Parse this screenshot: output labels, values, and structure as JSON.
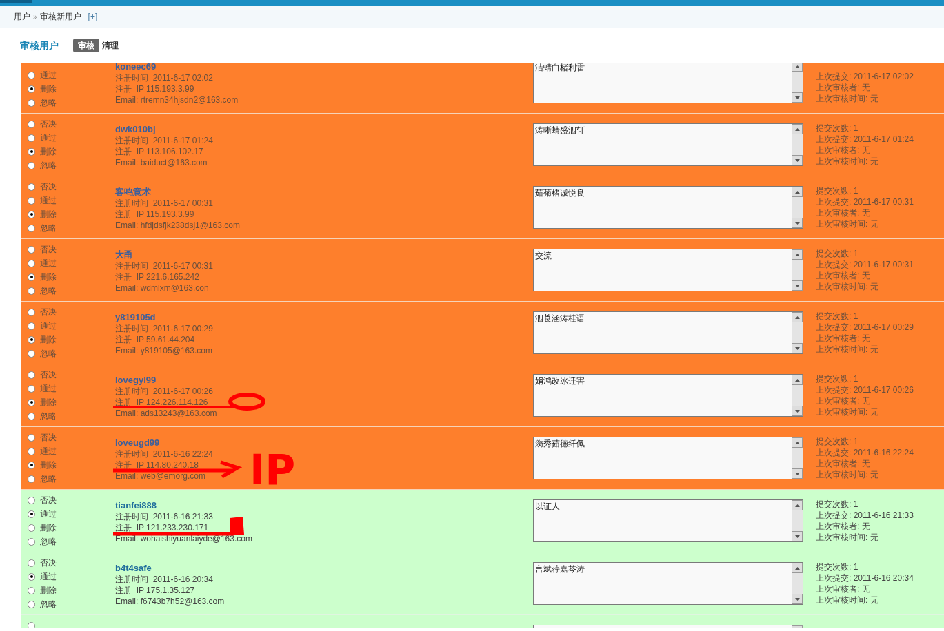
{
  "breadcrumb": {
    "items": [
      "用户",
      "审核新用户"
    ],
    "separator": "»",
    "add_link": "[+]"
  },
  "header": {
    "title": "审核用户",
    "tabs": [
      {
        "label": "审核",
        "selected": true
      },
      {
        "label": "清理",
        "selected": false
      }
    ]
  },
  "rows": [
    {
      "kind": "entry",
      "color": "#fe7f2c",
      "options": [
        {
          "label": "通过",
          "selected": false
        },
        {
          "label": "删除",
          "selected": true
        },
        {
          "label": "忽略",
          "selected": false
        }
      ],
      "username": "koneec69",
      "details": [
        "注册时间  2011-6-17 02:02",
        "注册  IP 115.193.3.99",
        "Email: rtremn34hjsdn2@163.com"
      ],
      "reason": "洁蜻白楮利雷",
      "stats": [
        "上次提交: 2011-6-17 02:02",
        "上次审核者: 无",
        "上次审核时间: 无"
      ]
    },
    {
      "kind": "entry",
      "color": "#fe7f2c",
      "options": [
        {
          "label": "否决",
          "selected": false
        },
        {
          "label": "通过",
          "selected": false
        },
        {
          "label": "删除",
          "selected": true
        },
        {
          "label": "忽略",
          "selected": false
        }
      ],
      "username": "dwk010bj",
      "details": [
        "注册时间  2011-6-17 01:24",
        "注册  IP 113.106.102.17",
        "Email: baiduct@163.com"
      ],
      "reason": "涛晰蜻盛泗轩",
      "stats": [
        "提交次数: 1",
        "上次提交: 2011-6-17 01:24",
        "上次审核者: 无",
        "上次审核时间: 无"
      ]
    },
    {
      "kind": "entry",
      "color": "#fe7f2c",
      "options": [
        {
          "label": "否决",
          "selected": false
        },
        {
          "label": "通过",
          "selected": false
        },
        {
          "label": "删除",
          "selected": true
        },
        {
          "label": "忽略",
          "selected": false
        }
      ],
      "username": "客鸣意术",
      "details": [
        "注册时间  2011-6-17 00:31",
        "注册  IP 115.193.3.99",
        "Email: hfdjdsfjk238dsj1@163.com"
      ],
      "reason": "茹菊楮诚悦良",
      "stats": [
        "提交次数: 1",
        "上次提交: 2011-6-17 00:31",
        "上次审核者: 无",
        "上次审核时间: 无"
      ]
    },
    {
      "kind": "entry",
      "color": "#fe7f2c",
      "options": [
        {
          "label": "否决",
          "selected": false
        },
        {
          "label": "通过",
          "selected": false
        },
        {
          "label": "删除",
          "selected": true
        },
        {
          "label": "忽略",
          "selected": false
        }
      ],
      "username": "大甬",
      "details": [
        "注册时间  2011-6-17 00:31",
        "注册  IP 221.6.165.242",
        "Email: wdmlxm@163.con"
      ],
      "reason": "交流",
      "stats": [
        "提交次数: 1",
        "上次提交: 2011-6-17 00:31",
        "上次审核者: 无",
        "上次审核时间: 无"
      ]
    },
    {
      "kind": "entry",
      "color": "#fe7f2c",
      "options": [
        {
          "label": "否决",
          "selected": false
        },
        {
          "label": "通过",
          "selected": false
        },
        {
          "label": "删除",
          "selected": true
        },
        {
          "label": "忽略",
          "selected": false
        }
      ],
      "username": "y819105d",
      "details": [
        "注册时间  2011-6-17 00:29",
        "注册  IP 59.61.44.204",
        "Email: y819105@163.com"
      ],
      "reason": "泗莨涵涛桂语",
      "stats": [
        "提交次数: 1",
        "上次提交: 2011-6-17 00:29",
        "上次审核者: 无",
        "上次审核时间: 无"
      ]
    },
    {
      "kind": "entry",
      "color": "#fe7f2c",
      "options": [
        {
          "label": "否决",
          "selected": false
        },
        {
          "label": "通过",
          "selected": false
        },
        {
          "label": "删除",
          "selected": true
        },
        {
          "label": "忽略",
          "selected": false
        }
      ],
      "username": "lovegyl99",
      "details": [
        "注册时间  2011-6-17 00:26",
        "注册  IP 124.226.114.126",
        "Email: ads13243@163.com"
      ],
      "reason": "娟鸿改冰迁害",
      "stats": [
        "提交次数: 1",
        "上次提交: 2011-6-17 00:26",
        "上次审核者: 无",
        "上次审核时间: 无"
      ]
    },
    {
      "kind": "entry",
      "color": "#fe7f2c",
      "options": [
        {
          "label": "否决",
          "selected": false
        },
        {
          "label": "通过",
          "selected": false
        },
        {
          "label": "删除",
          "selected": true
        },
        {
          "label": "忽略",
          "selected": false
        }
      ],
      "username": "loveugd99",
      "details": [
        "注册时间  2011-6-16 22:24",
        "注册  IP 114.80.240.18",
        "Email: web@emorg.com"
      ],
      "reason": "漪秀茹德纤佩",
      "stats": [
        "提交次数: 1",
        "上次提交: 2011-6-16 22:24",
        "上次审核者: 无",
        "上次审核时间: 无"
      ]
    },
    {
      "kind": "entry",
      "color": "#ccffcc",
      "options": [
        {
          "label": "否决",
          "selected": false
        },
        {
          "label": "通过",
          "selected": true
        },
        {
          "label": "删除",
          "selected": false
        },
        {
          "label": "忽略",
          "selected": false
        }
      ],
      "username": "tianfei888",
      "details": [
        "注册时间  2011-6-16 21:33",
        "注册  IP 121.233.230.171",
        "Email: wohaishiyuanlaiyde@163.com"
      ],
      "reason": "以证人",
      "stats": [
        "提交次数: 1",
        "上次提交: 2011-6-16 21:33",
        "上次审核者: 无",
        "上次审核时间: 无"
      ]
    },
    {
      "kind": "entry",
      "color": "#ccffcc",
      "options": [
        {
          "label": "否决",
          "selected": false
        },
        {
          "label": "通过",
          "selected": true
        },
        {
          "label": "删除",
          "selected": false
        },
        {
          "label": "忽略",
          "selected": false
        }
      ],
      "username": "b4t4safe",
      "details": [
        "注册时间  2011-6-16 20:34",
        "注册  IP 175.1.35.127",
        "Email: f6743b7h52@163.com"
      ],
      "reason": "言斌荇嘉芩涛",
      "stats": [
        "提交次数: 1",
        "上次提交: 2011-6-16 20:34",
        "上次审核者: 无",
        "上次审核时间: 无"
      ]
    },
    {
      "kind": "cut_off",
      "color": "#ccffcc"
    }
  ],
  "annotation": {
    "text": "IP"
  }
}
